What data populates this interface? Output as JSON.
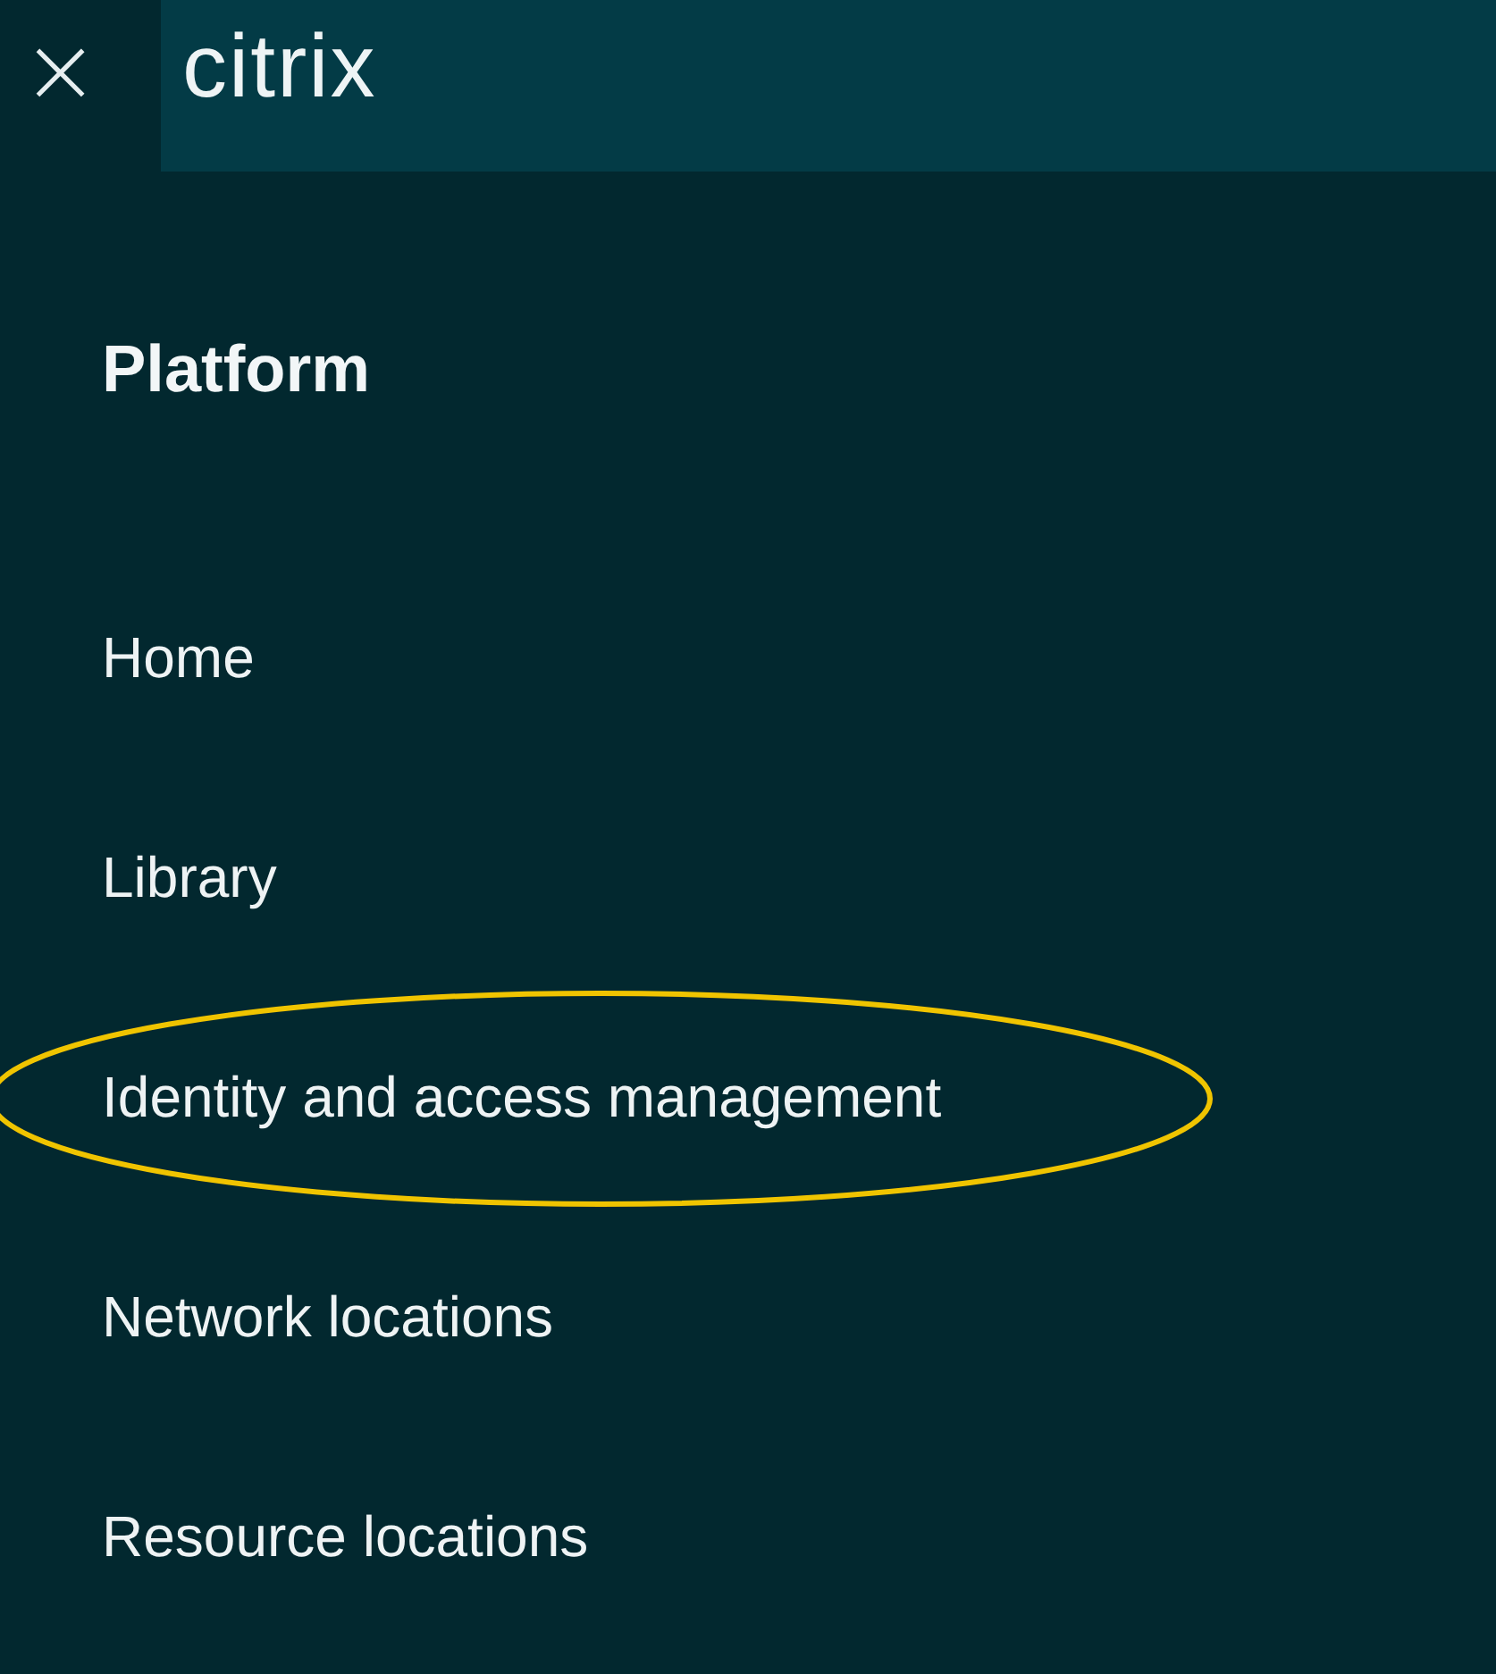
{
  "header": {
    "close": "×",
    "logo": "citrix"
  },
  "section": {
    "title": "Platform"
  },
  "nav_items": [
    {
      "label": "Home",
      "highlighted": false
    },
    {
      "label": "Library",
      "highlighted": false
    },
    {
      "label": "Identity and access management",
      "highlighted": true
    },
    {
      "label": "Network locations",
      "highlighted": false
    },
    {
      "label": "Resource locations",
      "highlighted": false
    }
  ]
}
